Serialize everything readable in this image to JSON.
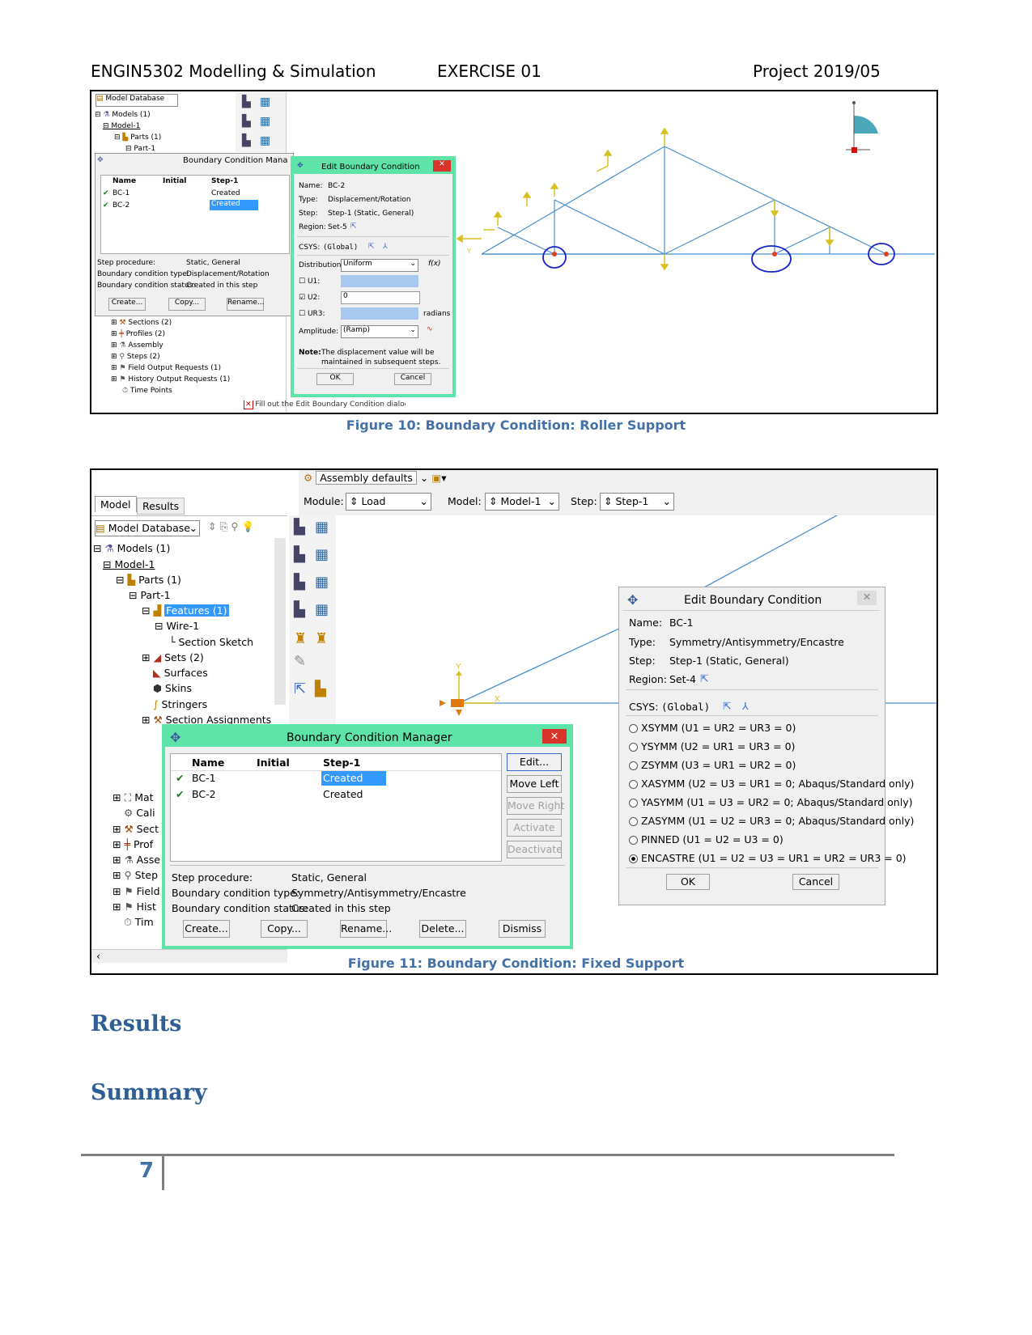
{
  "header": {
    "left": "ENGIN5302 Modelling & Simulation",
    "center": "EXERCISE 01",
    "right": "Project 2019/05"
  },
  "figure10": {
    "caption": "Figure 10: Boundary Condition: Roller Support",
    "tree_top": {
      "combo": "Model Database",
      "items": [
        "Models (1)",
        "Model-1",
        "Parts (1)",
        "Part-1"
      ]
    },
    "bcm": {
      "title": "Boundary Condition Mana",
      "col_name": "Name",
      "col_initial": "Initial",
      "col_step": "Step-1",
      "rows": [
        {
          "name": "BC-1",
          "step": "Created"
        },
        {
          "name": "BC-2",
          "step": "Created"
        }
      ],
      "step_procedure_label": "Step procedure:",
      "step_procedure": "Static, General",
      "bc_type_label": "Boundary condition type:",
      "bc_type": "Displacement/Rotation",
      "bc_status_label": "Boundary condition status:",
      "bc_status": "Created in this step",
      "create": "Create...",
      "copy": "Copy...",
      "rename": "Rename..."
    },
    "tree_bottom": [
      "Sections (2)",
      "Profiles (2)",
      "Assembly",
      "Steps (2)",
      "Field Output Requests (1)",
      "History Output Requests (1)",
      "Time Points"
    ],
    "ebc": {
      "title": "Edit Boundary Condition",
      "name_label": "Name:",
      "name": "BC-2",
      "type_label": "Type:",
      "type": "Displacement/Rotation",
      "step_label": "Step:",
      "step": "Step-1 (Static, General)",
      "region_label": "Region:",
      "region": "Set-5",
      "csys_label": "CSYS:",
      "csys": "(Global)",
      "dist_label": "Distribution:",
      "dist": "Uniform",
      "fx": "f(x)",
      "u1": "U1:",
      "u2": "U2:",
      "u2_value": "0",
      "ur3": "UR3:",
      "radians": "radians",
      "amp_label": "Amplitude:",
      "amp": "(Ramp)",
      "note_label": "Note:",
      "note1": "The displacement value will be",
      "note2": "maintained in subsequent steps.",
      "ok": "OK",
      "cancel": "Cancel"
    },
    "status": "Fill out the Edit Boundary Condition dialog"
  },
  "figure11": {
    "caption": "Figure 11: Boundary Condition: Fixed Support",
    "tabs": [
      "Model",
      "Results"
    ],
    "assembly_combo": "Assembly defaults",
    "module_label": "Module:",
    "module": "Load",
    "model_label": "Model:",
    "model": "Model-1",
    "step_label": "Step:",
    "step": "Step-1",
    "combo": "Model Database",
    "tree": [
      "Models (1)",
      "Model-1",
      "Parts (1)",
      "Part-1",
      "Features (1)",
      "Wire-1",
      "Section Sketch",
      "Sets (2)",
      "Surfaces",
      "Skins",
      "Stringers",
      "Section Assignments"
    ],
    "tree_cut": [
      "Mat",
      "Cali",
      "Sect",
      "Prof",
      "Asse",
      "Step",
      "Field",
      "Hist",
      "Tim"
    ],
    "bcm": {
      "title": "Boundary Condition Manager",
      "col_name": "Name",
      "col_initial": "Initial",
      "col_step": "Step-1",
      "rows": [
        {
          "name": "BC-1",
          "step": "Created"
        },
        {
          "name": "BC-2",
          "step": "Created"
        }
      ],
      "edit": "Edit...",
      "move_left": "Move Left",
      "move_right": "Move Right",
      "activate": "Activate",
      "deactivate": "Deactivate",
      "step_procedure_label": "Step procedure:",
      "step_procedure": "Static, General",
      "bc_type_label": "Boundary condition type:",
      "bc_type": "Symmetry/Antisymmetry/Encastre",
      "bc_status_label": "Boundary condition status:",
      "bc_status": "Created in this step",
      "create": "Create...",
      "copy": "Copy...",
      "rename": "Rename...",
      "delete": "Delete...",
      "dismiss": "Dismiss"
    },
    "ebc": {
      "title": "Edit Boundary Condition",
      "name_label": "Name:",
      "name": "BC-1",
      "type_label": "Type:",
      "type": "Symmetry/Antisymmetry/Encastre",
      "step_label": "Step:",
      "step": "Step-1 (Static, General)",
      "region_label": "Region:",
      "region": "Set-4",
      "csys_label": "CSYS:",
      "csys": "(Global)",
      "options": [
        "XSYMM (U1 = UR2 = UR3 = 0)",
        "YSYMM (U2 = UR1 = UR3 = 0)",
        "ZSYMM (U3 = UR1 = UR2 = 0)",
        "XASYMM (U2 = U3 = UR1 = 0; Abaqus/Standard only)",
        "YASYMM (U1 = U3 = UR2 = 0; Abaqus/Standard only)",
        "ZASYMM (U1 = U2 = UR3 = 0; Abaqus/Standard only)",
        "PINNED (U1 = U2 = U3 = 0)",
        "ENCASTRE (U1 = U2 = U3 = UR1 = UR2 = UR3 = 0)"
      ],
      "selected_index": 7,
      "ok": "OK",
      "cancel": "Cancel"
    },
    "axis_y": "Y",
    "axis_x": "X"
  },
  "sections": {
    "results": "Results",
    "summary": "Summary"
  },
  "footer": {
    "page": "7"
  },
  "colors": {
    "caption": "#4472a8",
    "heading": "#2e5e93",
    "dialog_border": "#5ee3a8",
    "truss": "#4a8fd0",
    "selection": "#3399ff"
  }
}
